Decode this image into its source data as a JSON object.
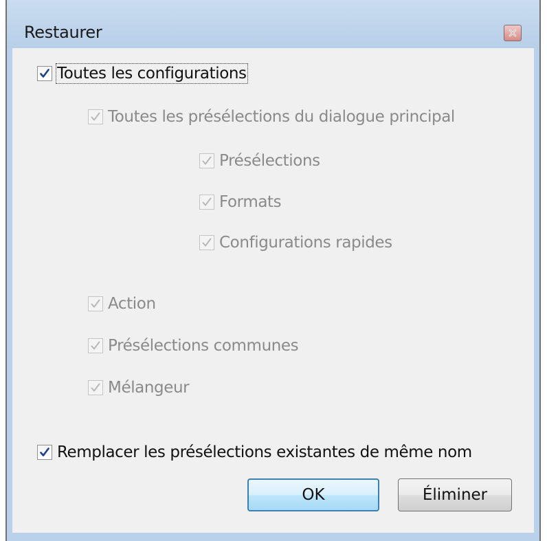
{
  "window": {
    "title": "Restaurer",
    "close_icon": "close-icon"
  },
  "options": {
    "all_configurations": {
      "label": "Toutes les configurations",
      "checked": true,
      "enabled": true
    },
    "all_main_presets": {
      "label": "Toutes les présélections du dialogue principal",
      "checked": true,
      "enabled": false
    },
    "presets": {
      "label": "Présélections",
      "checked": true,
      "enabled": false
    },
    "formats": {
      "label": "Formats",
      "checked": true,
      "enabled": false
    },
    "quick_configs": {
      "label": "Configurations rapides",
      "checked": true,
      "enabled": false
    },
    "action": {
      "label": "Action",
      "checked": true,
      "enabled": false
    },
    "common_presets": {
      "label": "Présélections communes",
      "checked": true,
      "enabled": false
    },
    "mixer": {
      "label": "Mélangeur",
      "checked": true,
      "enabled": false
    },
    "replace_existing": {
      "label": "Remplacer les présélections existantes de même nom",
      "checked": true,
      "enabled": true
    }
  },
  "buttons": {
    "ok": "OK",
    "delete": "Éliminer"
  },
  "colors": {
    "title_bar": "#b9d1ea",
    "client_bg": "#f0f0f0",
    "check_enabled": "#1f3f8f",
    "check_disabled": "#b8b8b8",
    "text_disabled": "#8a8a8a",
    "ok_border": "#3c7fb1"
  }
}
